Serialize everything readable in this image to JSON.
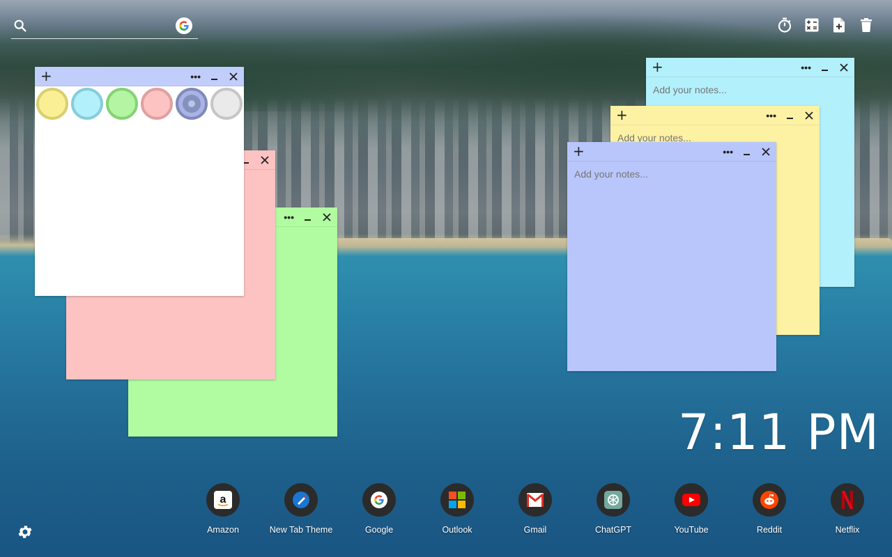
{
  "search": {
    "placeholder": ""
  },
  "notes": {
    "white": {
      "swatches": [
        "#fbef96",
        "#b2f0fc",
        "#b3f5a2",
        "#fdc2c2",
        "#aab3e6",
        "#eaeaea"
      ],
      "swatch_borders": [
        "#d9cf70",
        "#86cdd9",
        "#86d274",
        "#e0a0a0",
        "#7f8ab8",
        "#c6c6c6"
      ],
      "selected_swatch": 4
    },
    "cyan": {
      "placeholder": "Add your notes..."
    },
    "yellow": {
      "placeholder": "Add your notes..."
    },
    "blue": {
      "placeholder": "Add your notes..."
    }
  },
  "clock": {
    "time": "7:11 PM"
  },
  "dock": [
    {
      "label": "Amazon",
      "icon": "amazon-icon"
    },
    {
      "label": "New Tab Theme",
      "icon": "new-tab-theme-icon"
    },
    {
      "label": "Google",
      "icon": "google-icon"
    },
    {
      "label": "Outlook",
      "icon": "outlook-icon"
    },
    {
      "label": "Gmail",
      "icon": "gmail-icon"
    },
    {
      "label": "ChatGPT",
      "icon": "chatgpt-icon"
    },
    {
      "label": "YouTube",
      "icon": "youtube-icon"
    },
    {
      "label": "Reddit",
      "icon": "reddit-icon"
    },
    {
      "label": "Netflix",
      "icon": "netflix-icon"
    }
  ],
  "colors": {
    "clock": "#ffffff",
    "note_white_header": "#c1cdfb",
    "note_pink": "#fdc3c3",
    "note_green": "#b1fca0",
    "note_cyan": "#b2f0fc",
    "note_yellow": "#fdf2a3",
    "note_blue": "#b9c6fb"
  }
}
